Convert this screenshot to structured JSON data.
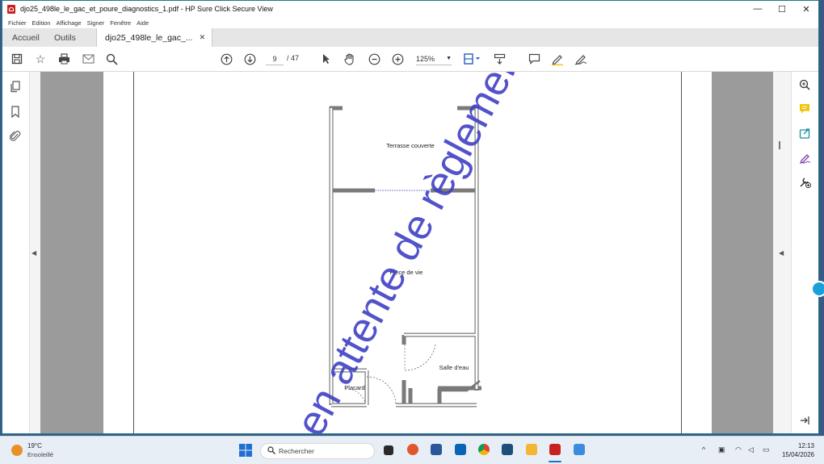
{
  "window": {
    "title": "djo25_498le_le_gac_et_poure_diagnostics_1.pdf - HP Sure Click Secure View",
    "minimize": "—",
    "maximize": "☐",
    "close": "✕"
  },
  "menu": [
    "Fichier",
    "Edition",
    "Affichage",
    "Signer",
    "Fenêtre",
    "Aide"
  ],
  "tabs": {
    "home": "Accueil",
    "tools": "Outils",
    "document": "djo25_498le_le_gac_...",
    "close": "✕"
  },
  "toolbar": {
    "current_page": "9",
    "total_pages": "/ 47",
    "zoom": "125%",
    "icons": [
      "save-icon",
      "bookmark-star-icon",
      "print-icon",
      "mail-icon",
      "search-icon",
      "page-up-icon",
      "page-down-icon",
      "select-arrow-icon",
      "hand-icon",
      "zoom-out-icon",
      "zoom-in-icon",
      "fit-page-icon",
      "scroll-mode-icon",
      "comment-icon",
      "highlight-pen-icon",
      "sign-icon"
    ]
  },
  "floorplan": {
    "rooms": {
      "terrace": "Terrasse couverte",
      "living": "Piece de vie",
      "bathroom": "Salle d'eau",
      "closet": "Placard"
    },
    "watermark": "en attente de règlement"
  },
  "left_panel_icons": [
    "pages-icon",
    "bookmark-icon",
    "attachment-icon"
  ],
  "right_panel_icons": [
    "zoom-icon",
    "comment-icon",
    "export-icon",
    "fill-sign-icon",
    "tools-icon"
  ],
  "taskbar": {
    "temperature": "19°C",
    "condition": "Ensoleillé",
    "search_placeholder": "Rechercher",
    "time": "12:13",
    "date": "15/04/2026"
  },
  "colors": {
    "pdf_red": "#c7221f",
    "watermark": "#3f3fc4",
    "wall": "#7a7a7a",
    "doc_bg": "#9b9b9b"
  }
}
